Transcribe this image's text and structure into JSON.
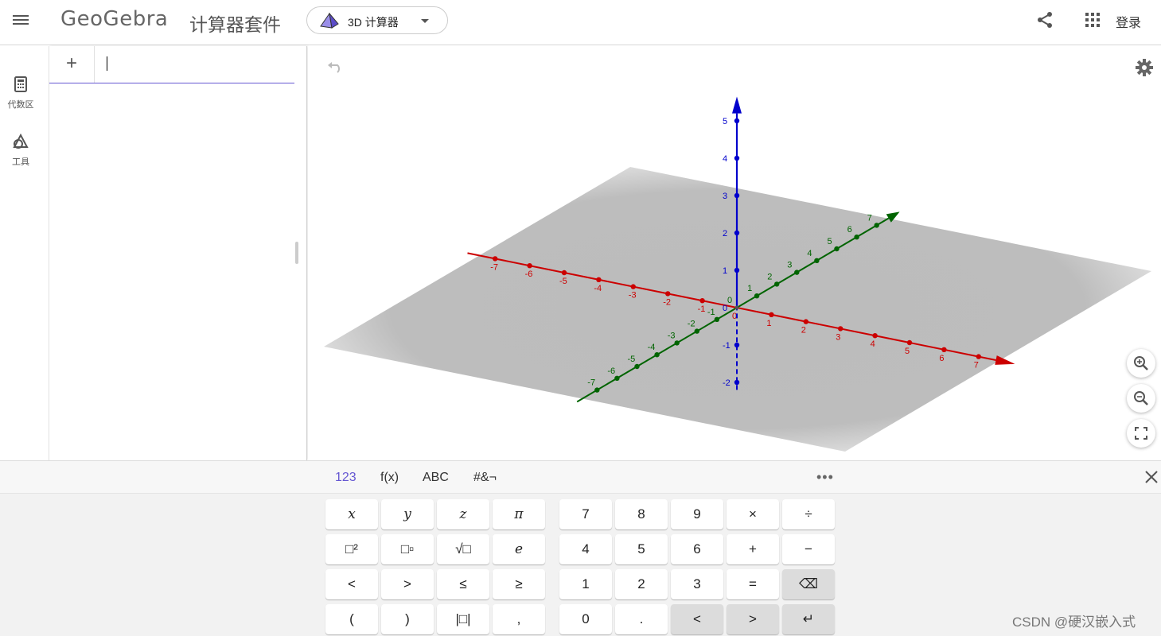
{
  "header": {
    "logo": "GeoGebra",
    "suite_title": "计算器套件",
    "app_selector": "3D 计算器",
    "signin": "登录"
  },
  "sidebar": {
    "items": [
      {
        "label": "代数区",
        "icon": "calculator-icon"
      },
      {
        "label": "工具",
        "icon": "tools-icon"
      }
    ]
  },
  "algebra": {
    "add_label": "+",
    "input_value": "",
    "input_placeholder": ""
  },
  "graphics": {
    "axes": {
      "x": {
        "color": "#cc0000",
        "ticks": [
          "-7",
          "-6",
          "-5",
          "-4",
          "-3",
          "-2",
          "-1",
          "0",
          "1",
          "2",
          "3",
          "4",
          "5",
          "6",
          "7"
        ]
      },
      "y": {
        "color": "#006400",
        "ticks": [
          "-7",
          "-6",
          "-5",
          "-4",
          "-3",
          "-2",
          "-1",
          "0",
          "1",
          "2",
          "3",
          "4",
          "5",
          "6",
          "7"
        ]
      },
      "z": {
        "color": "#0000cc",
        "ticks": [
          "-2",
          "-1",
          "0",
          "1",
          "2",
          "3",
          "4",
          "5"
        ]
      }
    },
    "plane_color": "#bcbcbc"
  },
  "keyboard": {
    "tabs": [
      "123",
      "f(x)",
      "ABC",
      "#&¬"
    ],
    "active_tab": "123",
    "more_label": "•••",
    "left_keys": [
      [
        "x",
        "y",
        "z",
        "π"
      ],
      [
        "□²",
        "□▫",
        "√□",
        "e"
      ],
      [
        "<",
        ">",
        "≤",
        "≥"
      ],
      [
        "(",
        ")",
        "|□|",
        ","
      ]
    ],
    "right_keys": [
      [
        "7",
        "8",
        "9",
        "×",
        "÷"
      ],
      [
        "4",
        "5",
        "6",
        "+",
        "−"
      ],
      [
        "1",
        "2",
        "3",
        "=",
        "⌫"
      ],
      [
        "0",
        ".",
        "<",
        ">",
        "↵"
      ]
    ]
  },
  "watermark": "CSDN @硬汉嵌入式"
}
